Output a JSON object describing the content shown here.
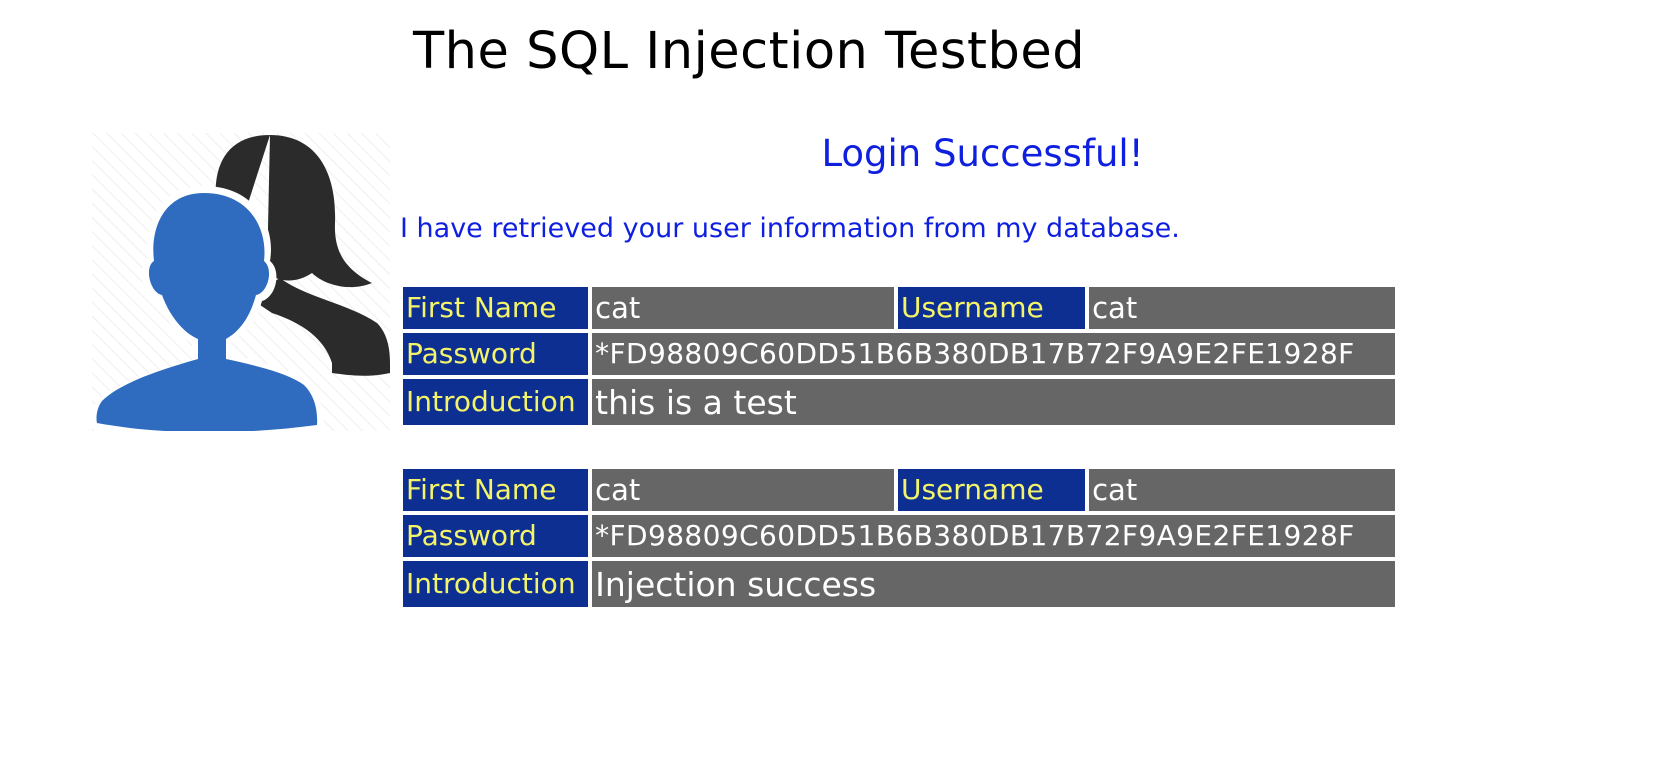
{
  "page": {
    "title": "The SQL Injection Testbed"
  },
  "result": {
    "heading": "Login Successful!",
    "message": "I have retrieved your user information from my database."
  },
  "labels": {
    "first_name": "First Name",
    "username": "Username",
    "password": "Password",
    "introduction": "Introduction"
  },
  "records": [
    {
      "first_name": "cat",
      "username": "cat",
      "password": "*FD98809C60DD51B6B380DB17B72F9A9E2FE1928F",
      "introduction": "this is a test"
    },
    {
      "first_name": "cat",
      "username": "cat",
      "password": "*FD98809C60DD51B6B380DB17B72F9A9E2FE1928F",
      "introduction": "Injection success"
    }
  ],
  "colors": {
    "heading_blue": "#0f1fe0",
    "label_bg": "#0d2f91",
    "label_text": "#f4f46a",
    "value_bg": "#666666",
    "value_text": "#ffffff",
    "avatar_front": "#2f6cbf",
    "avatar_back": "#2b2b2b"
  },
  "icons": {
    "avatar": "users-icon"
  }
}
